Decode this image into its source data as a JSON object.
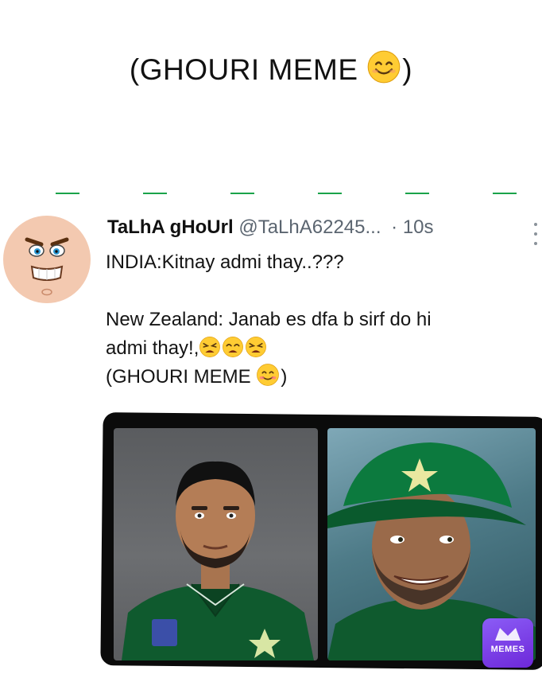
{
  "caption": {
    "text": "(GHOURI MEME ",
    "emoji_icon": "smiling-face-emoji",
    "close": ")"
  },
  "tweet": {
    "display_name": "TaLhA gHoUrl",
    "handle": "@TaLhA62245...",
    "time": "· 10s",
    "body": {
      "line1": "INDIA:Kitnay admi thay..???",
      "line2": "New Zealand: Janab es dfa b sirf do hi",
      "line3": "admi thay!,",
      "line3_emojis": [
        "tired-face-emoji",
        "weary-face-emoji",
        "tired-face-emoji"
      ],
      "line4": "(GHOURI MEME ",
      "line4_emoji": "smiling-face-emoji",
      "line4_close": ")"
    },
    "photo_left": "cricketer-portrait-left",
    "photo_right": "cricketer-portrait-right-green-cap"
  },
  "watermark": {
    "label": "MEMES"
  },
  "colors": {
    "dash_green": "#1aa34a",
    "handle_gray": "#5b6570",
    "jersey_green": "#0f5a2e",
    "cap_green": "#0c7a3e",
    "watermark_purple": "#7c3aed"
  }
}
